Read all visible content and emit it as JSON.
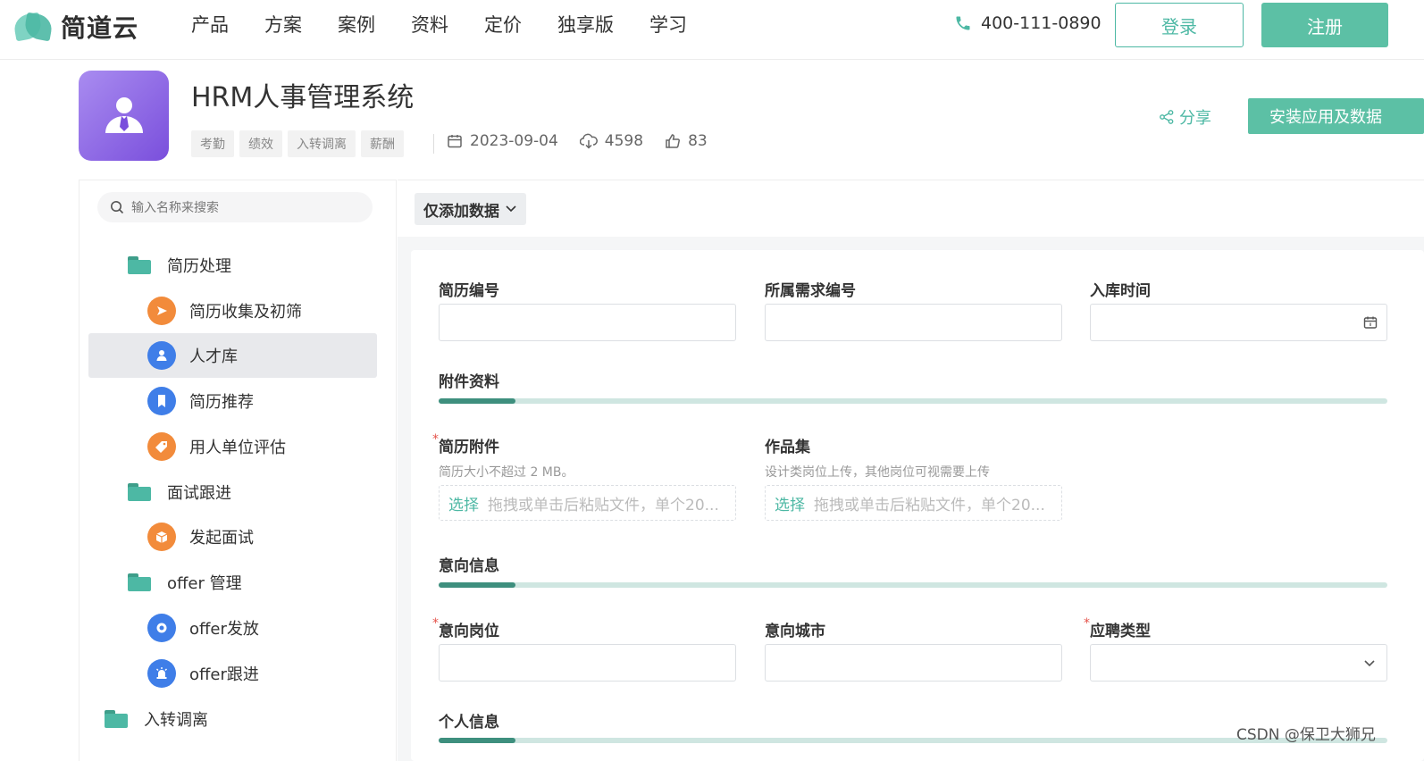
{
  "brand": {
    "name": "简道云"
  },
  "nav": {
    "items": [
      "产品",
      "方案",
      "案例",
      "资料",
      "定价",
      "独享版",
      "学习"
    ]
  },
  "header_actions": {
    "phone": "400-111-0890",
    "login": "登录",
    "register": "注册"
  },
  "app": {
    "title": "HRM人事管理系统",
    "tags": [
      "考勤",
      "绩效",
      "入转调离",
      "薪酬"
    ],
    "date": "2023-09-04",
    "downloads": "4598",
    "likes": "83",
    "share": "分享",
    "install": "安装应用及数据"
  },
  "sidebar": {
    "search_placeholder": "输入名称来搜索",
    "items": [
      {
        "label": "简历处理",
        "type": "folder"
      },
      {
        "label": "简历收集及初筛",
        "type": "form",
        "icon": "send-icon",
        "color": "#f28b3b"
      },
      {
        "label": "人才库",
        "type": "form",
        "icon": "user-icon",
        "color": "#3f7ee8",
        "active": true
      },
      {
        "label": "简历推荐",
        "type": "form",
        "icon": "bookmark-icon",
        "color": "#3f7ee8"
      },
      {
        "label": "用人单位评估",
        "type": "form",
        "icon": "tag-icon",
        "color": "#f28b3b"
      },
      {
        "label": "面试跟进",
        "type": "folder"
      },
      {
        "label": "发起面试",
        "type": "form",
        "icon": "box-icon",
        "color": "#f28b3b"
      },
      {
        "label": "offer 管理",
        "type": "folder"
      },
      {
        "label": "offer发放",
        "type": "form",
        "icon": "ring-icon",
        "color": "#3f7ee8"
      },
      {
        "label": "offer跟进",
        "type": "form",
        "icon": "alarm-icon",
        "color": "#3f7ee8"
      },
      {
        "label": "入转调离",
        "type": "folder"
      }
    ]
  },
  "toolbar": {
    "mode": "仅添加数据"
  },
  "form": {
    "fields_row1": [
      "简历编号",
      "所属需求编号",
      "入库时间"
    ],
    "section_attachments": "附件资料",
    "resume_attachment": {
      "label": "简历附件",
      "required": "*",
      "hint": "简历大小不超过 2 MB。",
      "pick": "选择",
      "drop_text": "拖拽或单击后粘贴文件，单个20..."
    },
    "portfolio": {
      "label": "作品集",
      "hint": "设计类岗位上传，其他岗位可视需要上传",
      "pick": "选择",
      "drop_text": "拖拽或单击后粘贴文件，单个20..."
    },
    "section_intent": "意向信息",
    "intent_position": {
      "label": "意向岗位",
      "required": "*"
    },
    "intent_city": {
      "label": "意向城市"
    },
    "apply_type": {
      "label": "应聘类型",
      "required": "*"
    },
    "section_personal": "个人信息"
  },
  "watermark": "CSDN @保卫大狮兄"
}
